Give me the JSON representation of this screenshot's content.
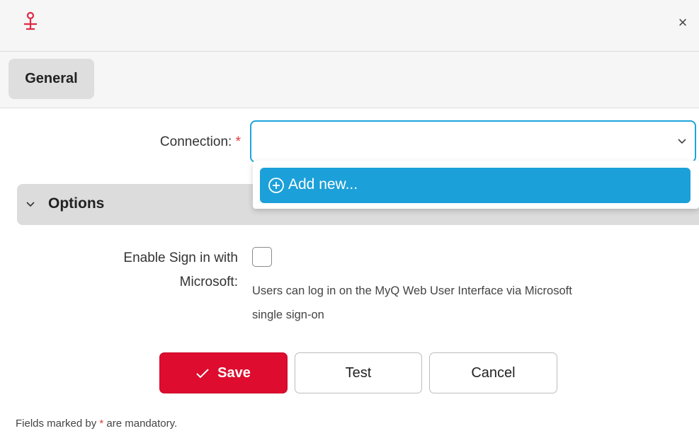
{
  "titlebar": {
    "app_icon": "myq-connector-icon",
    "close_label": "×",
    "brand_color": "#de2b45"
  },
  "tabs": [
    {
      "label": "General",
      "active": true
    }
  ],
  "form": {
    "connection": {
      "label": "Connection:",
      "required_mark": "*",
      "value": "",
      "dropdown": {
        "open": true,
        "items": [
          {
            "label": "Add new...",
            "icon": "plus-circle-icon",
            "highlighted": true
          }
        ]
      }
    },
    "options_section": {
      "title": "Options",
      "expanded": true
    },
    "sso": {
      "label_line1": "Enable Sign in with",
      "label_line2": "Microsoft:",
      "checked": false,
      "help_line1": "Users can log in on the MyQ Web User Interface via Microsoft",
      "help_line2": "single sign-on"
    }
  },
  "buttons": {
    "save": "Save",
    "test": "Test",
    "cancel": "Cancel"
  },
  "footnote": {
    "prefix": "Fields marked by ",
    "mark": "*",
    "suffix": " are mandatory."
  },
  "colors": {
    "accent": "#1ca0d9",
    "save": "#de0c2e",
    "required": "#e23b3b"
  }
}
